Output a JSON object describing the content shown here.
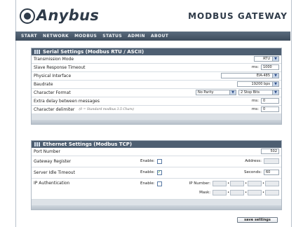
{
  "header": {
    "brand": "Anybus",
    "product": "MODBUS GATEWAY"
  },
  "nav": [
    "START",
    "NETWORK",
    "MODBUS",
    "STATUS",
    "ADMIN",
    "ABOUT"
  ],
  "serial": {
    "title": "Serial Settings (Modbus RTU / ASCII)",
    "transmission_mode": {
      "label": "Transmission Mode",
      "value": "RTU"
    },
    "slave_timeout": {
      "label": "Slave Response Timeout",
      "unit": "ms:",
      "value": "1000"
    },
    "physical_interface": {
      "label": "Physical Interface",
      "value": "EIA-485"
    },
    "baudrate": {
      "label": "Baudrate",
      "value": "19200 bps"
    },
    "character_format": {
      "label": "Character Format",
      "parity": "No Parity",
      "stop_bits": "2 Stop Bits"
    },
    "extra_delay": {
      "label": "Extra delay between messages",
      "unit": "ms:",
      "value": "0"
    },
    "char_delimiter": {
      "label": "Character delimiter",
      "note": "(0 = Standard modbus 3.5 Chars)",
      "unit": "ms:",
      "value": "0"
    }
  },
  "ethernet": {
    "title": "Ethernet Settings (Modbus TCP)",
    "port_number": {
      "label": "Port Number",
      "value": "502"
    },
    "gateway_register": {
      "label": "Gateway Register",
      "enable_label": "Enable:",
      "checked": false,
      "address_label": "Address:",
      "address_value": ""
    },
    "server_idle": {
      "label": "Server Idle Timeout",
      "enable_label": "Enable:",
      "checked": true,
      "seconds_label": "Seconds:",
      "seconds_value": "60"
    },
    "ip_auth": {
      "label": "IP Authentication",
      "enable_label": "Enable:",
      "checked": false,
      "ip_label": "IP Number:",
      "mask_label": "Mask:"
    }
  },
  "footer": {
    "save_label": "save settings"
  },
  "colors": {
    "header_bar": "#4e5f72",
    "nav_bar": "#4a5a6b",
    "check": "#3a9b2e"
  }
}
